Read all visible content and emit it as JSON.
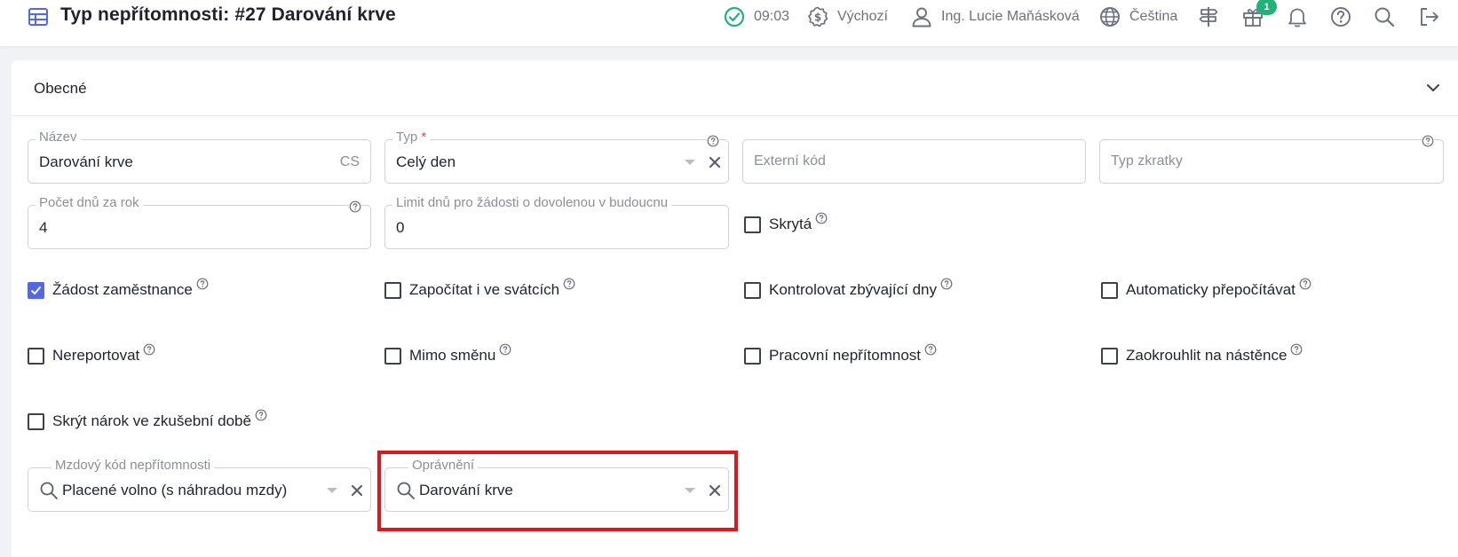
{
  "header": {
    "title": "Typ nepřítomnosti: #27 Darování krve",
    "time": "09:03",
    "company": "Výchozí",
    "user": "Ing. Lucie Maňásková",
    "language": "Čeština",
    "gift_badge": "1"
  },
  "section": {
    "title": "Obecné"
  },
  "fields": {
    "nazev": {
      "label": "Název",
      "value": "Darování krve",
      "suffix": "CS"
    },
    "typ": {
      "label": "Typ",
      "required_mark": "*",
      "value": "Celý den"
    },
    "externi_kod": {
      "placeholder": "Externí kód"
    },
    "typ_zkratky": {
      "placeholder": "Typ zkratky"
    },
    "pocet_dnu": {
      "label": "Počet dnů za rok",
      "value": "4"
    },
    "limit_dnu": {
      "label": "Limit dnů pro žádosti o dovolenou v budoucnu",
      "value": "0"
    },
    "mzdovy_kod": {
      "label": "Mzdový kód nepřítomnosti",
      "value": "Placené volno (s náhradou mzdy)"
    },
    "opravneni": {
      "label": "Oprávnění",
      "value": "Darování krve"
    }
  },
  "checkboxes": {
    "skryta": {
      "label": "Skrytá",
      "checked": false
    },
    "zadost": {
      "label": "Žádost zaměstnance",
      "checked": true
    },
    "zapocitat": {
      "label": "Započítat i ve svátcích",
      "checked": false
    },
    "kontrolovat": {
      "label": "Kontrolovat zbývající dny",
      "checked": false
    },
    "automaticky": {
      "label": "Automaticky přepočítávat",
      "checked": false
    },
    "nereportovat": {
      "label": "Nereportovat",
      "checked": false
    },
    "mimo_smenu": {
      "label": "Mimo směnu",
      "checked": false
    },
    "pracovni": {
      "label": "Pracovní nepřítomnost",
      "checked": false
    },
    "zaokrouhlit": {
      "label": "Zaokrouhlit na nástěnce",
      "checked": false
    },
    "skryt_narok": {
      "label": "Skrýt nárok ve zkušební době",
      "checked": false
    }
  },
  "colors": {
    "accent": "#5468e6",
    "success": "#21b27a",
    "highlight": "#e0161c"
  }
}
